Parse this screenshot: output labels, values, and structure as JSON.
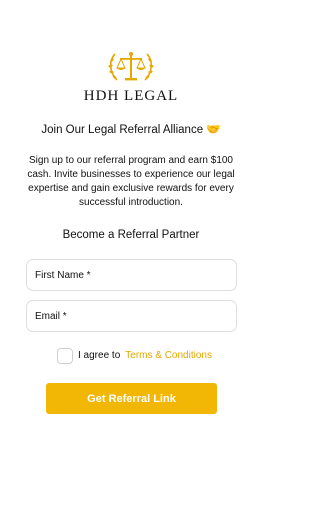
{
  "brand": {
    "logo_icon": "scales-of-justice-icon",
    "name": "HDH LEGAL",
    "accent": "#e5a800"
  },
  "headline": "Join Our Legal Referral Alliance 🤝",
  "intro": "Sign up to our referral program and earn $100 cash. Invite businesses to experience our legal expertise and gain exclusive rewards for every successful introduction.",
  "subhead": "Become a Referral Partner",
  "form": {
    "first_name_label": "First Name *",
    "email_label": "Email *",
    "agree_prefix": "I agree to",
    "terms_link": "Terms & Conditions",
    "submit_label": "Get Referral Link",
    "submit_color": "#f2b705"
  }
}
